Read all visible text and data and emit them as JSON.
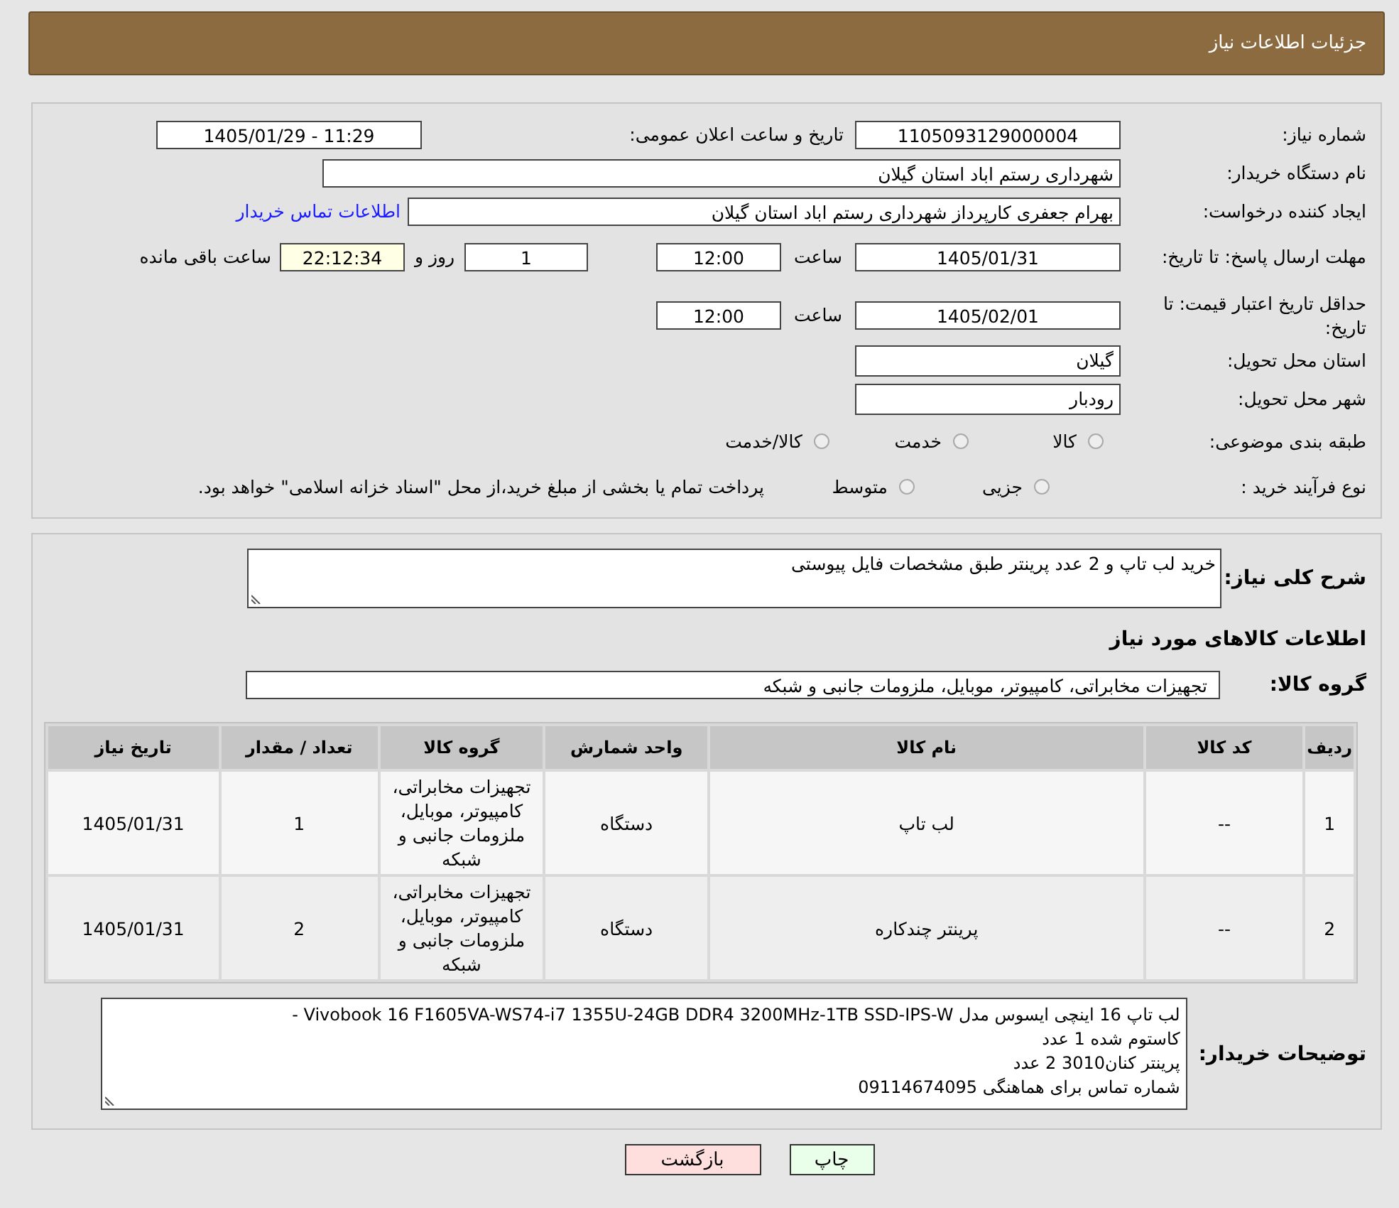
{
  "header": {
    "title": "جزئیات اطلاعات نیاز"
  },
  "details": {
    "need_number": {
      "label": "شماره نیاز:",
      "value": "1105093129000004"
    },
    "announce": {
      "label": "تاریخ و ساعت اعلان عمومی:",
      "value": "1405/01/29 - 11:29"
    },
    "buyer_org": {
      "label": "نام دستگاه خریدار:",
      "value": "شهرداری رستم اباد استان گیلان"
    },
    "requester": {
      "label": "ایجاد کننده درخواست:",
      "value": "بهرام جعفری کارپرداز شهرداری رستم اباد استان گیلان",
      "link": "اطلاعات تماس خریدار"
    },
    "reply_deadline": {
      "label": "مهلت ارسال پاسخ: تا تاریخ:",
      "date": "1405/01/31",
      "time_label": "ساعت",
      "time": "12:00",
      "days": "1",
      "days_label": "روز و",
      "remaining": "22:12:34",
      "remaining_label": "ساعت باقی مانده"
    },
    "price_validity": {
      "label": "حداقل تاریخ اعتبار قیمت: تا تاریخ:",
      "date": "1405/02/01",
      "time_label": "ساعت",
      "time": "12:00"
    },
    "province": {
      "label": "استان محل تحویل:",
      "value": "گیلان"
    },
    "city": {
      "label": "شهر محل تحویل:",
      "value": "رودبار"
    },
    "category": {
      "label": "طبقه بندی موضوعی:",
      "options": [
        {
          "label": "کالا",
          "selected": false
        },
        {
          "label": "خدمت",
          "selected": false
        },
        {
          "label": "کالا/خدمت",
          "selected": false
        }
      ]
    },
    "purchase_type": {
      "label": "نوع فرآیند خرید :",
      "options": [
        {
          "label": "جزیی",
          "selected": false
        },
        {
          "label": "متوسط",
          "selected": false
        }
      ],
      "note": "پرداخت تمام یا بخشی از مبلغ خرید،از محل \"اسناد خزانه اسلامی\" خواهد بود."
    }
  },
  "items": {
    "description": {
      "label": "شرح کلی نیاز:",
      "value": "خرید لب تاپ و 2 عدد پرینتر طبق مشخصات فایل پیوستی"
    },
    "heading": "اطلاعات کالاهای مورد نیاز",
    "group": {
      "label": "گروه کالا:",
      "value": "تجهیزات مخابراتی، کامپیوتر، موبایل، ملزومات جانبی و شبکه"
    },
    "table": {
      "columns": [
        "ردیف",
        "کد کالا",
        "نام کالا",
        "واحد شمارش",
        "گروه کالا",
        "تعداد / مقدار",
        "تاریخ نیاز"
      ],
      "rows": [
        {
          "cells": [
            "1",
            "--",
            "لب تاپ",
            "دستگاه",
            "تجهیزات مخابراتی، کامپیوتر، موبایل، ملزومات جانبی و شبکه",
            "1",
            "1405/01/31"
          ]
        },
        {
          "cells": [
            "2",
            "--",
            "پرینتر چندکاره",
            "دستگاه",
            "تجهیزات مخابراتی، کامپیوتر، موبایل، ملزومات جانبی و شبکه",
            "2",
            "1405/01/31"
          ]
        }
      ]
    },
    "buyer_notes": {
      "label": "توضیحات خریدار:",
      "lines": [
        "لب تاپ 16 اینچی ایسوس مدل Vivobook 16 F1605VA-WS74-i7 1355U-24GB DDR4 3200MHz-1TB SSD-IPS-W -",
        "کاستوم شده 1 عدد",
        "پرینتر کنان3010 2 عدد",
        "شماره تماس برای هماهنگی 09114674095"
      ]
    }
  },
  "actions": [
    {
      "label": "چاپ",
      "kind": "print"
    },
    {
      "label": "بازگشت",
      "kind": "back"
    }
  ]
}
